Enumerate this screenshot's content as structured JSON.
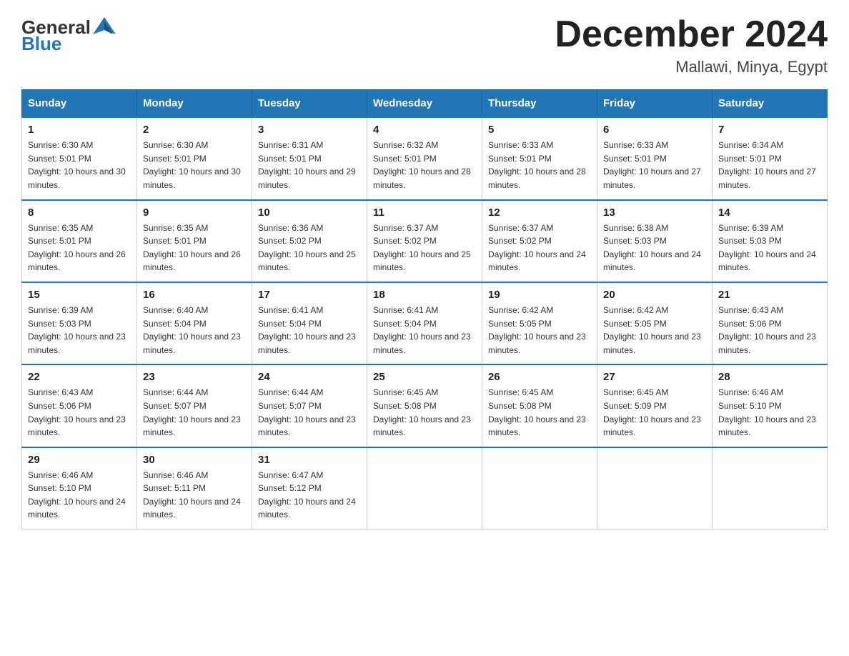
{
  "header": {
    "logo_general": "General",
    "logo_blue": "Blue",
    "title": "December 2024",
    "location": "Mallawi, Minya, Egypt"
  },
  "days_of_week": [
    "Sunday",
    "Monday",
    "Tuesday",
    "Wednesday",
    "Thursday",
    "Friday",
    "Saturday"
  ],
  "weeks": [
    [
      {
        "day": "1",
        "sunrise": "6:30 AM",
        "sunset": "5:01 PM",
        "daylight": "10 hours and 30 minutes."
      },
      {
        "day": "2",
        "sunrise": "6:30 AM",
        "sunset": "5:01 PM",
        "daylight": "10 hours and 30 minutes."
      },
      {
        "day": "3",
        "sunrise": "6:31 AM",
        "sunset": "5:01 PM",
        "daylight": "10 hours and 29 minutes."
      },
      {
        "day": "4",
        "sunrise": "6:32 AM",
        "sunset": "5:01 PM",
        "daylight": "10 hours and 28 minutes."
      },
      {
        "day": "5",
        "sunrise": "6:33 AM",
        "sunset": "5:01 PM",
        "daylight": "10 hours and 28 minutes."
      },
      {
        "day": "6",
        "sunrise": "6:33 AM",
        "sunset": "5:01 PM",
        "daylight": "10 hours and 27 minutes."
      },
      {
        "day": "7",
        "sunrise": "6:34 AM",
        "sunset": "5:01 PM",
        "daylight": "10 hours and 27 minutes."
      }
    ],
    [
      {
        "day": "8",
        "sunrise": "6:35 AM",
        "sunset": "5:01 PM",
        "daylight": "10 hours and 26 minutes."
      },
      {
        "day": "9",
        "sunrise": "6:35 AM",
        "sunset": "5:01 PM",
        "daylight": "10 hours and 26 minutes."
      },
      {
        "day": "10",
        "sunrise": "6:36 AM",
        "sunset": "5:02 PM",
        "daylight": "10 hours and 25 minutes."
      },
      {
        "day": "11",
        "sunrise": "6:37 AM",
        "sunset": "5:02 PM",
        "daylight": "10 hours and 25 minutes."
      },
      {
        "day": "12",
        "sunrise": "6:37 AM",
        "sunset": "5:02 PM",
        "daylight": "10 hours and 24 minutes."
      },
      {
        "day": "13",
        "sunrise": "6:38 AM",
        "sunset": "5:03 PM",
        "daylight": "10 hours and 24 minutes."
      },
      {
        "day": "14",
        "sunrise": "6:39 AM",
        "sunset": "5:03 PM",
        "daylight": "10 hours and 24 minutes."
      }
    ],
    [
      {
        "day": "15",
        "sunrise": "6:39 AM",
        "sunset": "5:03 PM",
        "daylight": "10 hours and 23 minutes."
      },
      {
        "day": "16",
        "sunrise": "6:40 AM",
        "sunset": "5:04 PM",
        "daylight": "10 hours and 23 minutes."
      },
      {
        "day": "17",
        "sunrise": "6:41 AM",
        "sunset": "5:04 PM",
        "daylight": "10 hours and 23 minutes."
      },
      {
        "day": "18",
        "sunrise": "6:41 AM",
        "sunset": "5:04 PM",
        "daylight": "10 hours and 23 minutes."
      },
      {
        "day": "19",
        "sunrise": "6:42 AM",
        "sunset": "5:05 PM",
        "daylight": "10 hours and 23 minutes."
      },
      {
        "day": "20",
        "sunrise": "6:42 AM",
        "sunset": "5:05 PM",
        "daylight": "10 hours and 23 minutes."
      },
      {
        "day": "21",
        "sunrise": "6:43 AM",
        "sunset": "5:06 PM",
        "daylight": "10 hours and 23 minutes."
      }
    ],
    [
      {
        "day": "22",
        "sunrise": "6:43 AM",
        "sunset": "5:06 PM",
        "daylight": "10 hours and 23 minutes."
      },
      {
        "day": "23",
        "sunrise": "6:44 AM",
        "sunset": "5:07 PM",
        "daylight": "10 hours and 23 minutes."
      },
      {
        "day": "24",
        "sunrise": "6:44 AM",
        "sunset": "5:07 PM",
        "daylight": "10 hours and 23 minutes."
      },
      {
        "day": "25",
        "sunrise": "6:45 AM",
        "sunset": "5:08 PM",
        "daylight": "10 hours and 23 minutes."
      },
      {
        "day": "26",
        "sunrise": "6:45 AM",
        "sunset": "5:08 PM",
        "daylight": "10 hours and 23 minutes."
      },
      {
        "day": "27",
        "sunrise": "6:45 AM",
        "sunset": "5:09 PM",
        "daylight": "10 hours and 23 minutes."
      },
      {
        "day": "28",
        "sunrise": "6:46 AM",
        "sunset": "5:10 PM",
        "daylight": "10 hours and 23 minutes."
      }
    ],
    [
      {
        "day": "29",
        "sunrise": "6:46 AM",
        "sunset": "5:10 PM",
        "daylight": "10 hours and 24 minutes."
      },
      {
        "day": "30",
        "sunrise": "6:46 AM",
        "sunset": "5:11 PM",
        "daylight": "10 hours and 24 minutes."
      },
      {
        "day": "31",
        "sunrise": "6:47 AM",
        "sunset": "5:12 PM",
        "daylight": "10 hours and 24 minutes."
      },
      null,
      null,
      null,
      null
    ]
  ],
  "labels": {
    "sunrise": "Sunrise:",
    "sunset": "Sunset:",
    "daylight": "Daylight:"
  }
}
